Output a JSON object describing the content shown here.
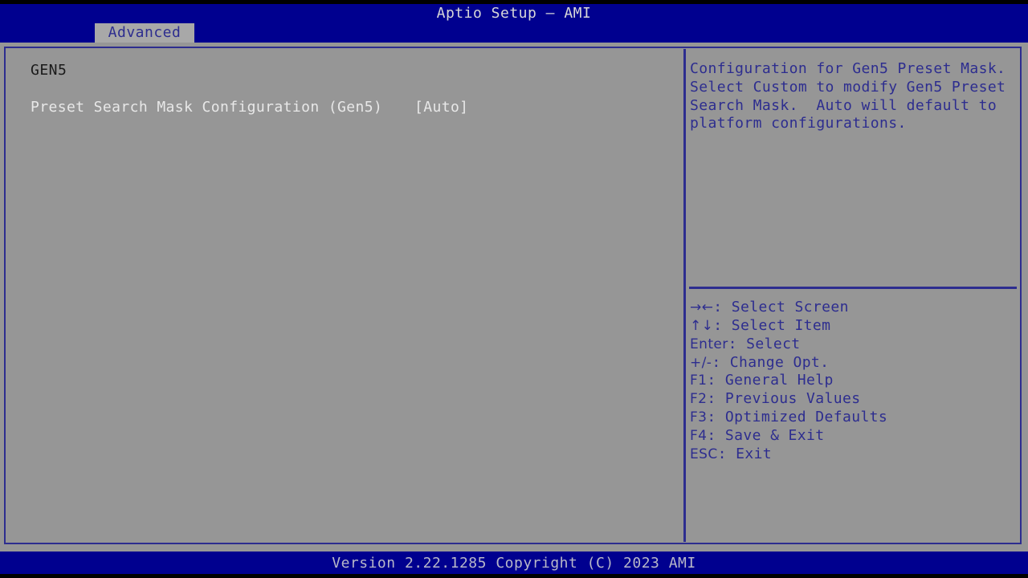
{
  "window": {
    "title": "Aptio Setup – AMI"
  },
  "tabs": [
    {
      "label": "Advanced",
      "selected": true
    }
  ],
  "main": {
    "group_heading": "GEN5",
    "options": [
      {
        "label": "Preset Search Mask Configuration (Gen5)",
        "value": "[Auto]"
      }
    ]
  },
  "help": {
    "text": "Configuration for Gen5 Preset Mask.  Select Custom to modify Gen5 Preset Search Mask.  Auto will default to platform configurations."
  },
  "legend": [
    {
      "keys": "→←",
      "separator": ": ",
      "action": "Select Screen"
    },
    {
      "keys": "↑↓",
      "separator": ": ",
      "action": "Select Item"
    },
    {
      "keys": "Enter",
      "separator": ": ",
      "action": "Select"
    },
    {
      "keys": "+/-",
      "separator": ": ",
      "action": "Change Opt."
    },
    {
      "keys": "F1",
      "separator": ": ",
      "action": "General Help"
    },
    {
      "keys": "F2",
      "separator": ": ",
      "action": "Previous Values"
    },
    {
      "keys": "F3",
      "separator": ": ",
      "action": "Optimized Defaults"
    },
    {
      "keys": "F4",
      "separator": ": ",
      "action": "Save & Exit"
    },
    {
      "keys": "ESC",
      "separator": ": ",
      "action": "Exit"
    }
  ],
  "footer": {
    "version_text": "Version 2.22.1285 Copyright (C) 2023 AMI"
  },
  "colors": {
    "background_gray": "#969696",
    "bar_blue": "#00008f",
    "text_blue": "#2d2d8f",
    "text_white": "#e8e8e8",
    "heading_black": "#1a1a1a"
  }
}
